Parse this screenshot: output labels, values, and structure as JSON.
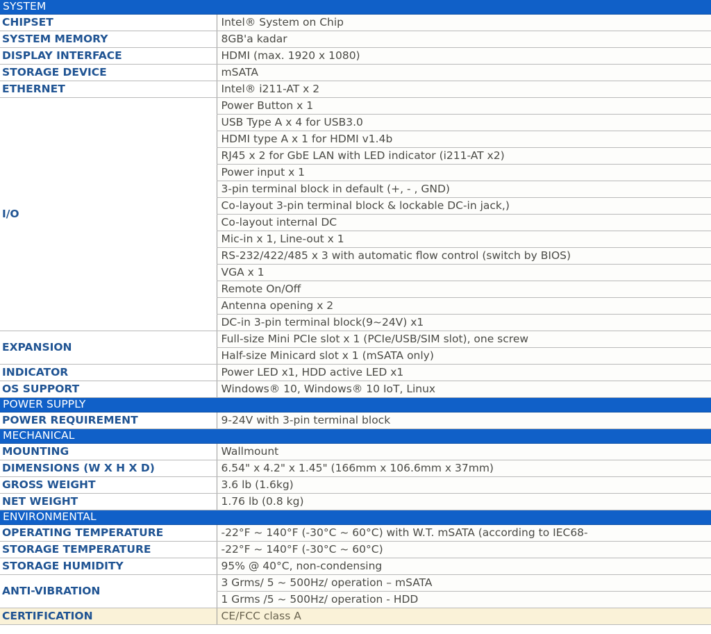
{
  "document": {
    "title": "Product Specification Table",
    "accent_blue": "#1060c8",
    "label_color": "#205493",
    "value_color": "#4a4a45",
    "highlight_cream": "#faf2d8"
  },
  "sections": [
    {
      "name": "system-section",
      "header": "SYSTEM",
      "rows": [
        {
          "label": "CHIPSET",
          "values": [
            "Intel® System on Chip"
          ]
        },
        {
          "label": "SYSTEM MEMORY",
          "values": [
            "8GB'a kadar"
          ]
        },
        {
          "label": "DISPLAY INTERFACE",
          "values": [
            "HDMI (max. 1920 x 1080)"
          ]
        },
        {
          "label": "STORAGE DEVICE",
          "values": [
            "mSATA"
          ]
        },
        {
          "label": "ETHERNET",
          "values": [
            "Intel® i211-AT x 2"
          ]
        },
        {
          "label": "I/O",
          "values": [
            "Power Button x 1",
            "USB Type A x 4 for USB3.0",
            "HDMI type A x 1 for HDMI v1.4b",
            "RJ45 x 2 for GbE LAN with LED indicator (i211-AT x2)",
            "Power input x 1",
            "3-pin terminal block in default (+, - , GND)",
            "Co-layout 3-pin terminal block & lockable DC-in jack,)",
            "Co-layout internal DC",
            "Mic-in x 1, Line-out x 1",
            "RS-232/422/485 x 3 with automatic flow control (switch by BIOS)",
            "VGA x 1",
            "Remote On/Off",
            "Antenna opening x 2",
            "DC-in 3-pin terminal block(9~24V) x1"
          ]
        },
        {
          "label": "EXPANSION",
          "values": [
            "Full-size Mini PCIe slot x 1 (PCIe/USB/SIM slot), one screw",
            "Half-size Minicard slot x 1 (mSATA only)"
          ]
        },
        {
          "label": "INDICATOR",
          "values": [
            "Power LED x1, HDD active LED x1"
          ]
        },
        {
          "label": "OS SUPPORT",
          "values": [
            "Windows® 10, Windows® 10 IoT, Linux"
          ]
        }
      ]
    },
    {
      "name": "power-supply-section",
      "header": "POWER SUPPLY",
      "rows": [
        {
          "label": "POWER REQUIREMENT",
          "values": [
            "9-24V with 3-pin terminal block"
          ]
        }
      ]
    },
    {
      "name": "mechanical-section",
      "header": "MECHANICAL",
      "rows": [
        {
          "label": "MOUNTING",
          "values": [
            "Wallmount"
          ]
        },
        {
          "label": "DIMENSIONS (W X H X D)",
          "values": [
            "6.54\" x 4.2\" x 1.45\" (166mm x 106.6mm x 37mm)"
          ]
        },
        {
          "label": "GROSS WEIGHT",
          "values": [
            "3.6 lb (1.6kg)"
          ]
        },
        {
          "label": "NET WEIGHT",
          "values": [
            "1.76 lb (0.8 kg)"
          ]
        }
      ]
    },
    {
      "name": "environmental-section",
      "header": "ENVIRONMENTAL",
      "rows": [
        {
          "label": "OPERATING TEMPERATURE",
          "values": [
            "-22°F ~ 140°F (-30°C ~ 60°C) with W.T. mSATA (according to IEC68-"
          ]
        },
        {
          "label": "STORAGE TEMPERATURE",
          "values": [
            "-22°F ~ 140°F (-30°C ~ 60°C)"
          ]
        },
        {
          "label": "STORAGE HUMIDITY",
          "values": [
            "95% @ 40°C, non-condensing"
          ]
        },
        {
          "label": "ANTI-VIBRATION",
          "values": [
            "3 Grms/ 5 ~ 500Hz/ operation – mSATA",
            "1 Grms /5 ~ 500Hz/ operation - HDD"
          ]
        },
        {
          "label": "CERTIFICATION",
          "highlight": true,
          "values": [
            "CE/FCC class A"
          ]
        }
      ]
    }
  ]
}
